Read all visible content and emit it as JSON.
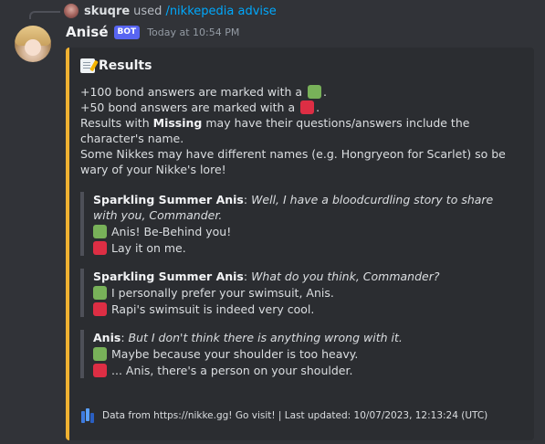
{
  "command": {
    "user": "skuqre",
    "used_text": "used",
    "name": "/nikkepedia advise"
  },
  "message": {
    "author": "Anisé",
    "bot_tag": "BOT",
    "timestamp": "Today at 10:54 PM"
  },
  "embed": {
    "accent_color": "#f0b232",
    "title_icon": "memo-icon",
    "title": "Results",
    "desc": {
      "line1_a": "+100 bond answers are marked with a",
      "line1_b": ".",
      "line2_a": "+50 bond answers are marked with a",
      "line2_b": ".",
      "line3_a": "Results with",
      "line3_bold": "Missing",
      "line3_b": "may have their questions/answers include the character's name.",
      "line4": "Some Nikkes may have different names (e.g. Hongryeon for Scarlet) so be wary of your Nikke's lore!"
    },
    "quotes": [
      {
        "speaker": "Sparkling Summer Anis",
        "line": "Well, I have a bloodcurdling story to share with you, Commander.",
        "good_answer": "Anis! Be-Behind you!",
        "bad_answer": "Lay it on me."
      },
      {
        "speaker": "Sparkling Summer Anis",
        "line": "What do you think, Commander?",
        "good_answer": "I personally prefer your swimsuit, Anis.",
        "bad_answer": "Rapi's swimsuit is indeed very cool."
      },
      {
        "speaker": "Anis",
        "line": "But I don't think there is anything wrong with it.",
        "good_answer": "Maybe because your shoulder is too heavy.",
        "bad_answer": "... Anis, there's a person on your shoulder."
      }
    ],
    "footer_icon": "nikke-gg-icon",
    "footer": "Data from https://nikke.gg! Go visit! | Last updated: 10/07/2023, 12:13:24 (UTC)"
  },
  "colors": {
    "green_marker": "#78b159",
    "red_marker": "#dd2e44",
    "link": "#00a8fc",
    "bot_tag": "#5865f2"
  }
}
